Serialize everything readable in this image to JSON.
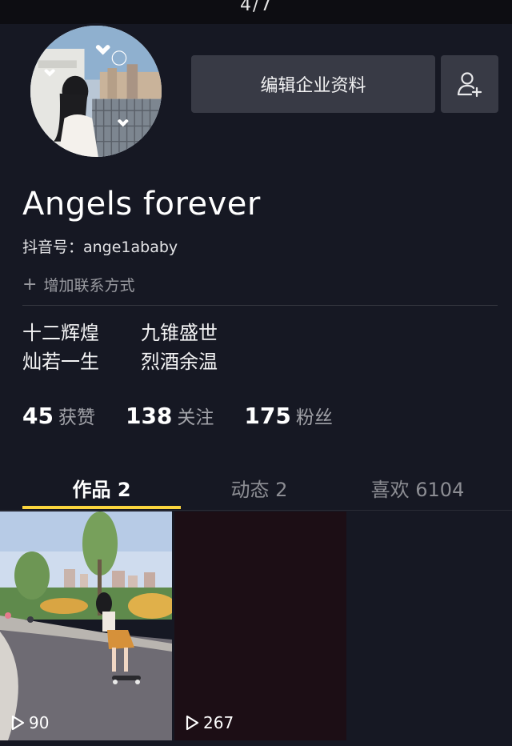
{
  "header": {
    "cover_text": "4/7"
  },
  "profile": {
    "edit_button_label": "编辑企业资料",
    "nickname": "Angels forever",
    "douyin_id": "抖音号：ange1ababy",
    "add_contact_label": "增加联系方式",
    "bio": [
      [
        "十二辉煌",
        "九锥盛世"
      ],
      [
        "灿若一生",
        "烈酒余温"
      ]
    ]
  },
  "stats": [
    {
      "value": "45",
      "label": "获赞"
    },
    {
      "value": "138",
      "label": "关注"
    },
    {
      "value": "175",
      "label": "粉丝"
    }
  ],
  "tabs": [
    {
      "label": "作品 2",
      "active": true
    },
    {
      "label": "动态 2",
      "active": false
    },
    {
      "label": "喜欢 6104",
      "active": false
    }
  ],
  "videos": [
    {
      "plays": "90"
    },
    {
      "plays": "267"
    }
  ],
  "colors": {
    "background": "#161823",
    "button": "#383a45",
    "tab_indicator": "#fbd53d"
  },
  "icons": {
    "add_friend": "add-user-icon",
    "play": "play-icon",
    "plus": "plus-icon"
  }
}
